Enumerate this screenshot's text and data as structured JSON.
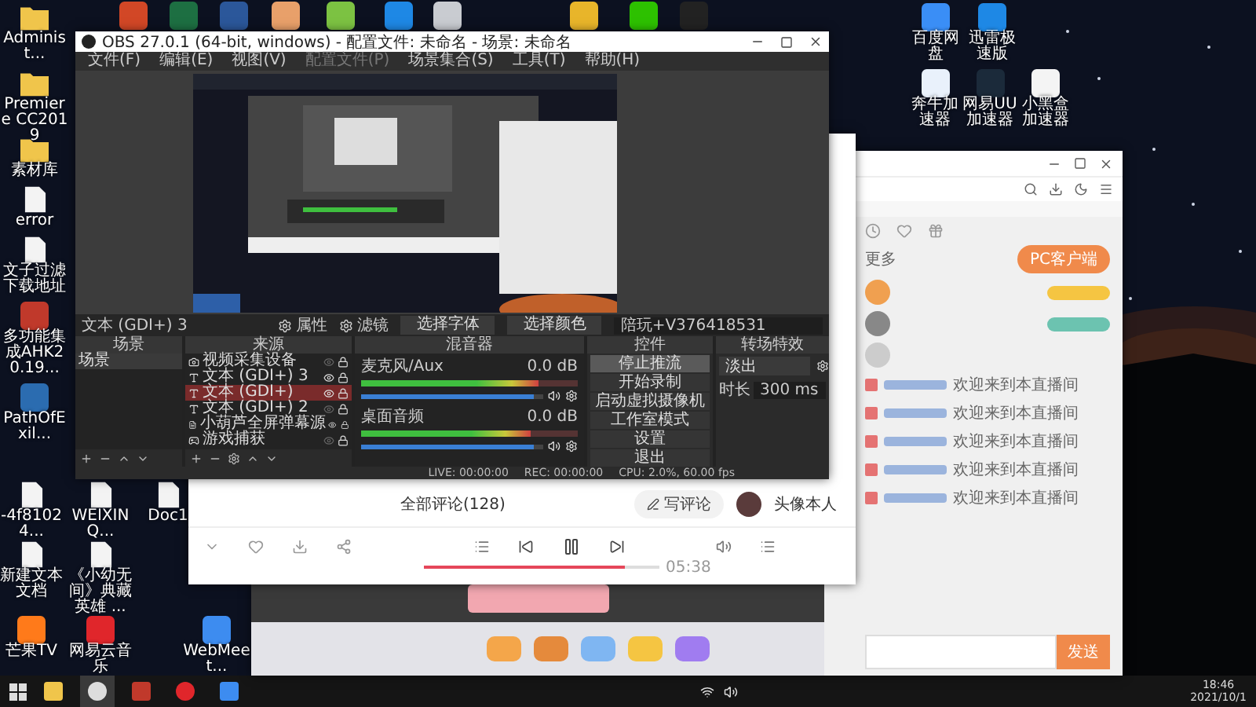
{
  "desktop": {
    "icons": [
      {
        "kind": "app",
        "color": "#d24726"
      },
      {
        "kind": "app",
        "color": "#1d6f42"
      },
      {
        "kind": "app",
        "color": "#2b579a"
      },
      {
        "kind": "app",
        "color": "#e8a06a"
      },
      {
        "kind": "app",
        "color": "#7cc242"
      },
      {
        "kind": "app",
        "color": "#1e88e5"
      },
      {
        "kind": "app",
        "color": "#c9ccd1"
      },
      {
        "kind": "app",
        "color": "#e8b52a"
      },
      {
        "kind": "app",
        "color": "#2dc100"
      },
      {
        "kind": "app",
        "color": "#222222"
      },
      {
        "kind": "app",
        "color": "#3a8ef6",
        "label": "百度网盘"
      },
      {
        "kind": "app",
        "color": "#1e88e5",
        "label": "迅雷极速版"
      },
      {
        "kind": "app",
        "color": "#e9f1fb",
        "label": "奔牛加速器"
      },
      {
        "kind": "app",
        "color": "#1b2a3a",
        "label": "网易UU加速器"
      },
      {
        "kind": "app",
        "color": "#f4f4f4",
        "label": "小黑盒加速器"
      },
      {
        "kind": "folder",
        "label": "Administ..."
      },
      {
        "kind": "folder",
        "label": "Premiere CC2019"
      },
      {
        "kind": "folder",
        "label": "素材库"
      },
      {
        "kind": "file",
        "label": "error"
      },
      {
        "kind": "file",
        "label": "文子过滤下载地址"
      },
      {
        "kind": "app",
        "color": "#c0392b",
        "label": "多功能集成AHK20.19..."
      },
      {
        "kind": "app",
        "color": "#2b6cb0",
        "label": "PathOfExil..."
      },
      {
        "kind": "file",
        "label": "-4f81024..."
      },
      {
        "kind": "file",
        "label": "新建文本文档"
      },
      {
        "kind": "app",
        "color": "#ff7a1a",
        "label": "芒果TV"
      },
      {
        "kind": "file",
        "label": "WEIXINQ..."
      },
      {
        "kind": "file",
        "label": "《小幼无间》典藏英雄 ..."
      },
      {
        "kind": "app",
        "color": "#e0262b",
        "label": "网易云音乐"
      },
      {
        "kind": "file",
        "label": "Doc1"
      },
      {
        "kind": "app",
        "color": "#3d8cf0",
        "label": "WebMeet..."
      }
    ]
  },
  "browser": {
    "more": "更多",
    "pc_client": "PC客户端",
    "chat": [
      {
        "message": "欢迎来到本直播间"
      },
      {
        "message": "欢迎来到本直播间"
      },
      {
        "message": "欢迎来到本直播间"
      },
      {
        "message": "欢迎来到本直播间"
      },
      {
        "message": "欢迎来到本直播间"
      }
    ],
    "send": "发送"
  },
  "music": {
    "comments_title": "全部评论(128)",
    "write_button": "写评论",
    "author": "头像本人",
    "progress": {
      "level": 0.85
    },
    "total": "05:38"
  },
  "obs": {
    "title": "OBS 27.0.1 (64-bit, windows) - 配置文件: 未命名 - 场景: 未命名",
    "menu": [
      {
        "label": "文件(F)",
        "disabled": false
      },
      {
        "label": "编辑(E)",
        "disabled": false
      },
      {
        "label": "视图(V)",
        "disabled": false
      },
      {
        "label": "配置文件(P)",
        "disabled": true
      },
      {
        "label": "场景集合(S)",
        "disabled": false
      },
      {
        "label": "工具(T)",
        "disabled": false
      },
      {
        "label": "帮助(H)",
        "disabled": false
      }
    ],
    "source_bar": {
      "source": "文本 (GDI+) 3",
      "properties": "属性",
      "filters": "滤镜",
      "buttons": [
        "选择字体",
        "选择颜色"
      ],
      "text_value": "陪玩+V376418531"
    },
    "scenes": {
      "title": "场景",
      "items": [
        {
          "label": "场景",
          "selected": true
        }
      ]
    },
    "sources": {
      "title": "来源",
      "items": [
        {
          "kind": "camera",
          "label": "视频采集设备",
          "visible": false,
          "selected": false
        },
        {
          "kind": "text",
          "label": "文本 (GDI+) 3",
          "visible": true,
          "selected": false
        },
        {
          "kind": "text",
          "label": "文本 (GDI+)",
          "visible": true,
          "selected": true
        },
        {
          "kind": "text",
          "label": "文本 (GDI+) 2",
          "visible": false,
          "selected": false
        },
        {
          "kind": "file",
          "label": "小葫芦全屏弹幕源",
          "visible": true,
          "selected": false
        },
        {
          "kind": "game",
          "label": "游戏捕获",
          "visible": false,
          "selected": false
        }
      ]
    },
    "mixer": {
      "title": "混音器",
      "channels": [
        {
          "name": "麦克风/Aux",
          "reading": "0.0 dB",
          "meter": {
            "level": 0.82
          },
          "volume": {
            "level": 0.95
          }
        },
        {
          "name": "桌面音频",
          "reading": "0.0 dB",
          "meter": {
            "level": 0.78
          },
          "volume": {
            "level": 0.95
          }
        }
      ]
    },
    "controls": {
      "title": "控件",
      "buttons": [
        {
          "label": "停止推流",
          "active": true
        },
        {
          "label": "开始录制",
          "active": false
        },
        {
          "label": "启动虚拟摄像机",
          "active": false
        },
        {
          "label": "工作室模式",
          "active": false
        },
        {
          "label": "设置",
          "active": false
        },
        {
          "label": "退出",
          "active": false
        }
      ]
    },
    "transitions": {
      "title": "转场特效",
      "effect": "淡出",
      "duration_label": "时长",
      "duration": "300 ms"
    },
    "status": [
      "LIVE: 00:00:00",
      "REC: 00:00:00",
      "CPU: 2.0%, 60.00 fps"
    ]
  },
  "taskbar": {
    "apps": [
      {
        "kind": "explorer",
        "active": false
      },
      {
        "kind": "obs",
        "active": true
      },
      {
        "kind": "red",
        "active": false
      },
      {
        "kind": "netease",
        "active": false
      },
      {
        "kind": "browser",
        "active": false
      }
    ],
    "clock": "18:46",
    "date": "2021/10/1"
  }
}
